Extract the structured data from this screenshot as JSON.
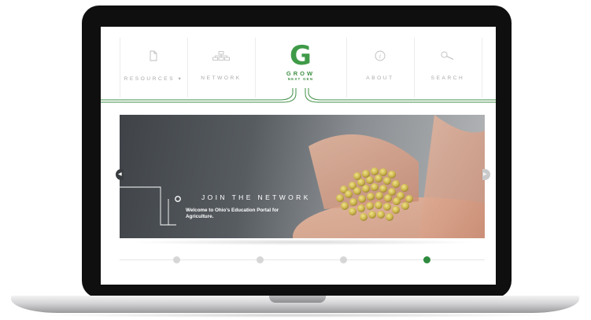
{
  "nav": {
    "items": [
      {
        "label": "RESOURCES ▾",
        "icon": "document-icon"
      },
      {
        "label": "NETWORK",
        "icon": "network-icon"
      },
      {
        "label": "ABOUT",
        "icon": "info-icon"
      },
      {
        "label": "SEARCH",
        "icon": "search-icon"
      }
    ],
    "logo": {
      "letter": "G",
      "word": "GROW",
      "tagline": "NEXT GEN"
    }
  },
  "hero": {
    "title": "JOIN THE NETWORK",
    "text": "Welcome to Ohio's Education Portal for Agriculture."
  },
  "pager": {
    "count": 4,
    "active_index": 3
  },
  "colors": {
    "brand_green": "#3f9a48",
    "active_dot": "#2e8a3e",
    "inactive_dot": "#d6d6d6"
  }
}
